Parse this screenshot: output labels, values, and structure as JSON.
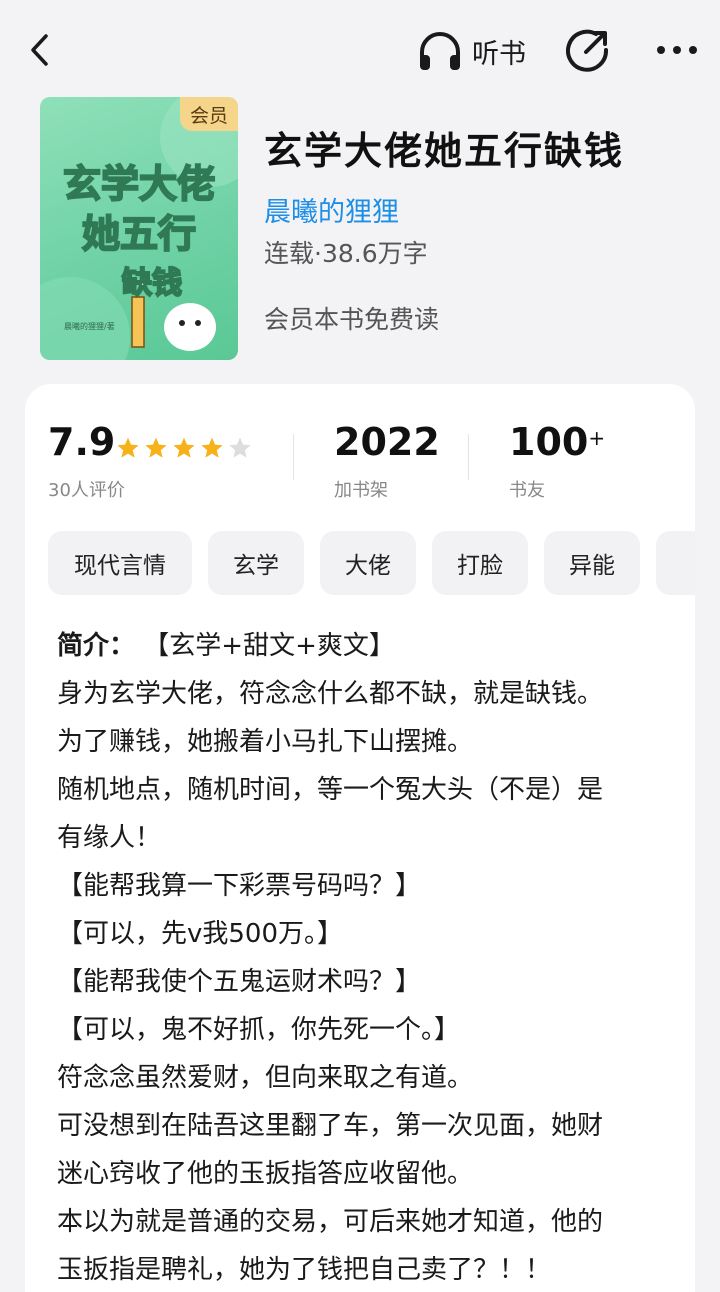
{
  "topbar": {
    "listen_label": "听书"
  },
  "book": {
    "title": "玄学大佬她五行缺钱",
    "author": "晨曦的狸狸",
    "status": "连载·38.6万字",
    "vip_note": "会员本书免费读",
    "cover_badge": "会员",
    "cover_title_lines": [
      "玄学大佬",
      "她五行",
      "缺钱"
    ],
    "cover_author": "晨曦的狸狸/著"
  },
  "stats": {
    "score": "7.9",
    "rating_count": "30人评价",
    "stars_filled": 4,
    "stars_total": 5,
    "shelf_count": "2022",
    "shelf_label": "加书架",
    "friends_count": "100",
    "friends_plus": "+",
    "friends_label": "书友"
  },
  "tags": [
    "现代言情",
    "玄学",
    "大佬",
    "打脸",
    "异能"
  ],
  "synopsis": {
    "head": "简介：",
    "head_rest": "【玄学+甜文+爽文】",
    "lines": [
      "身为玄学大佬，符念念什么都不缺，就是缺钱。",
      "为了赚钱，她搬着小马扎下山摆摊。",
      "随机地点，随机时间，等一个冤大头（不是）是",
      "有缘人！",
      "【能帮我算一下彩票号码吗？】",
      "【可以，先v我500万。】",
      "【能帮我使个五鬼运财术吗？】",
      "【可以，鬼不好抓，你先死一个。】",
      "符念念虽然爱财，但向来取之有道。",
      "可没想到在陆吾这里翻了车，第一次见面，她财",
      "迷心窍收了他的玉扳指答应收留他。",
      "本以为就是普通的交易，可后来她才知道，他的",
      "玉扳指是聘礼，她为了钱把自己卖了？！！"
    ]
  },
  "colors": {
    "accent_blue": "#1e8fe6",
    "star_filled": "#f7b21b",
    "star_empty": "#dddddd",
    "cover_green": "#6fd2a6"
  }
}
